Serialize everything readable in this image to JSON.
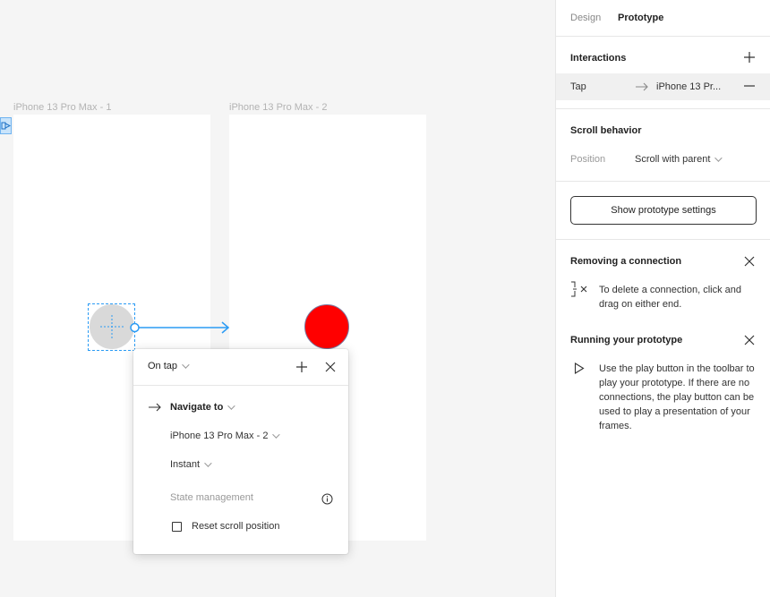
{
  "canvas": {
    "frame1_label": "iPhone 13 Pro Max - 1",
    "frame2_label": "iPhone 13 Pro Max - 2"
  },
  "popup": {
    "trigger": "On tap",
    "action": "Navigate to",
    "destination": "iPhone 13 Pro Max - 2",
    "animation": "Instant",
    "state_management_label": "State management",
    "reset_scroll_label": "Reset scroll position",
    "reset_scroll_checked": false
  },
  "panel": {
    "tabs": [
      "Design",
      "Prototype"
    ],
    "active_tab": "Prototype",
    "interactions": {
      "title": "Interactions",
      "trigger": "Tap",
      "destination": "iPhone 13 Pr..."
    },
    "scroll_behavior": {
      "title": "Scroll behavior",
      "position_label": "Position",
      "position_value": "Scroll with parent"
    },
    "show_settings_button": "Show prototype settings",
    "removing_connection": {
      "title": "Removing a connection",
      "text": "To delete a connection, click and drag on either end."
    },
    "running_prototype": {
      "title": "Running your prototype",
      "text": "Use the play button in the toolbar to play your prototype. If there are no connections, the play button can be used to play a presentation of your frames."
    }
  },
  "colors": {
    "accent_blue": "#2b9bf4",
    "destination_circle": "#ff0000",
    "source_circle": "#d9d9d9"
  }
}
